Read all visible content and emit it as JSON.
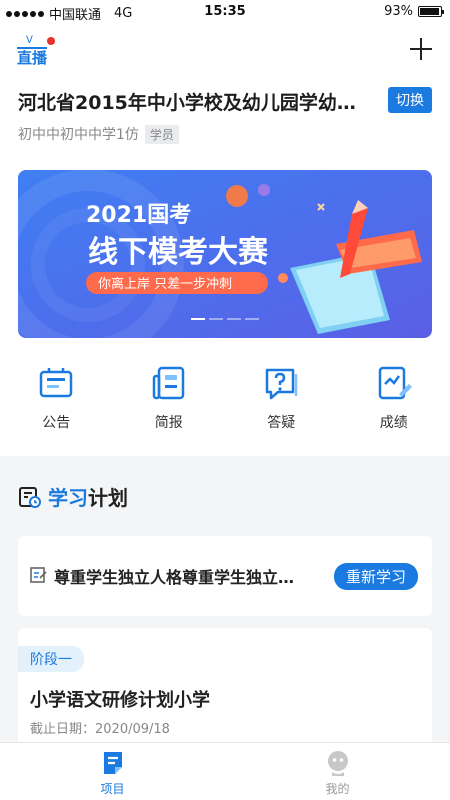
{
  "status_bar": {
    "carrier": "中国联通",
    "network": "4G",
    "time": "15:35",
    "battery": "93%",
    "battery_level": 0.93
  },
  "header": {
    "logo_text": "直播",
    "project_title": "河北省2015年中小学校及幼儿园学幼…",
    "switch_label": "切换",
    "subtitle": "初中中初中中学1仿",
    "role": "学员"
  },
  "banner": {
    "line1": "2021国考",
    "line2": "线下模考大赛",
    "tagline": "你离上岸  只差一步冲刺"
  },
  "quick_nav": [
    {
      "label": "公告",
      "icon": "announcement-icon"
    },
    {
      "label": "简报",
      "icon": "briefing-icon"
    },
    {
      "label": "答疑",
      "icon": "qa-icon"
    },
    {
      "label": "成绩",
      "icon": "score-icon"
    }
  ],
  "study_plan": {
    "title_highlight": "学习",
    "title_rest": "计划",
    "current_item": "尊重学生独立人格尊重学生独立人格",
    "restudy_label": "重新学习",
    "stage": "阶段一",
    "course_title": "小学语文研修计划小学",
    "deadline": "截止日期：2020/09/18"
  },
  "tab_bar": {
    "project": "项目",
    "mine": "我的"
  },
  "colors": {
    "accent": "#1b7ae0",
    "banner_bg": "#4a7cf0",
    "tag_bg": "#e3f1fc"
  }
}
